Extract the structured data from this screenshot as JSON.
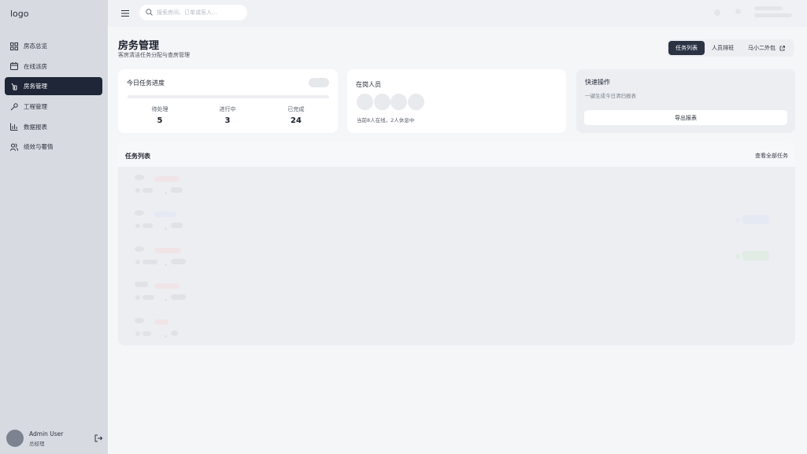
{
  "app": {
    "logo": "logo"
  },
  "sidebar": {
    "items": [
      {
        "label": "房态总览",
        "icon": "grid-icon",
        "active": false
      },
      {
        "label": "在线派房",
        "icon": "calendar-icon",
        "active": false
      },
      {
        "label": "房务管理",
        "icon": "broom-icon",
        "active": true
      },
      {
        "label": "工程管理",
        "icon": "wrench-icon",
        "active": false
      },
      {
        "label": "数据报表",
        "icon": "bar-chart-icon",
        "active": false
      },
      {
        "label": "绩效与奢情",
        "icon": "users-icon",
        "active": false
      }
    ],
    "user": {
      "name": "Admin User",
      "role": "总经理"
    }
  },
  "header": {
    "search": {
      "placeholder": "搜索房间、订单或客人..."
    }
  },
  "page": {
    "title": "房务管理",
    "subtitle": "客房清洁任务分配与查房管理",
    "tabs": [
      {
        "label": "任务列表",
        "active": true
      },
      {
        "label": "人员排班",
        "active": false
      },
      {
        "label": "马小二外包",
        "active": false,
        "icon": "external-link-icon"
      }
    ]
  },
  "progress_card": {
    "title": "今日任务进度",
    "stats": [
      {
        "label": "待处理",
        "value": "5"
      },
      {
        "label": "进行中",
        "value": "3"
      },
      {
        "label": "已完成",
        "value": "24"
      }
    ]
  },
  "staff_card": {
    "title": "在岗人员",
    "status": "当前8人在线，2人休息中"
  },
  "quick_card": {
    "title": "快速操作",
    "subtitle": "一键生成今日清扫报表",
    "button": "导出报表"
  },
  "task_list": {
    "title": "任务列表",
    "view_all": "查看全部任务"
  },
  "colors": {
    "sidebar_bg": "#d7dae1",
    "active_nav": "#1e2637",
    "active_tab": "#2b3345",
    "page_bg": "#f5f6f8"
  }
}
